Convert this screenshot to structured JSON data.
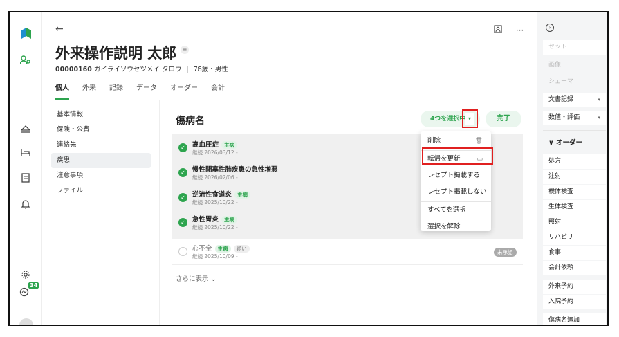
{
  "header": {
    "patient_name": "外来操作説明 太郎",
    "patient_id": "00000160",
    "patient_kana": "ガイライソウセツメイ タロウ",
    "age_sex": "76歳・男性"
  },
  "tabs": [
    "個人",
    "外来",
    "記録",
    "データ",
    "オーダー",
    "会計"
  ],
  "subnav": [
    "基本情報",
    "保険・公費",
    "連絡先",
    "疾患",
    "注意事項",
    "ファイル"
  ],
  "content": {
    "title": "傷病名",
    "select_button": "4つを選択中",
    "done_button": "完了",
    "more_link": "さらに表示 ⌄",
    "unapproved_label": "未承認"
  },
  "diseases": [
    {
      "name": "高血圧症",
      "tag": "主病",
      "tag2": "",
      "sub": "継続 2026/03/12 -"
    },
    {
      "name": "慢性閉塞性肺疾患の急性増悪",
      "tag": "",
      "tag2": "",
      "sub": "継続 2026/02/06 -"
    },
    {
      "name": "逆流性食道炎",
      "tag": "主病",
      "tag2": "",
      "sub": "継続 2025/10/22 -"
    },
    {
      "name": "急性胃炎",
      "tag": "主病",
      "tag2": "",
      "sub": "継続 2025/10/22 -"
    },
    {
      "name": "心不全",
      "tag": "主病",
      "tag2": "疑い",
      "sub": "継続 2025/10/09 -"
    }
  ],
  "menu": [
    "削除",
    "転帰を更新",
    "レセプト掲載する",
    "レセプト掲載しない",
    "すべてを選択",
    "選択を解除"
  ],
  "right_panel": {
    "set_placeholder": "セット",
    "image_placeholder": "画像",
    "schema_placeholder": "シェーマ",
    "doc_record": "文書記録",
    "values_eval": "数値・評価",
    "order_head": "∨ オーダー",
    "orders": [
      "処方",
      "注射",
      "検体検査",
      "生体検査",
      "照射",
      "リハビリ",
      "食事",
      "会計依頼"
    ],
    "reservations": [
      "外来予約",
      "入院予約"
    ],
    "add_disease": "傷病名追加"
  },
  "notifications": {
    "count": "34"
  },
  "colors": {
    "accent": "#2da44e",
    "highlight": "#e02020"
  }
}
